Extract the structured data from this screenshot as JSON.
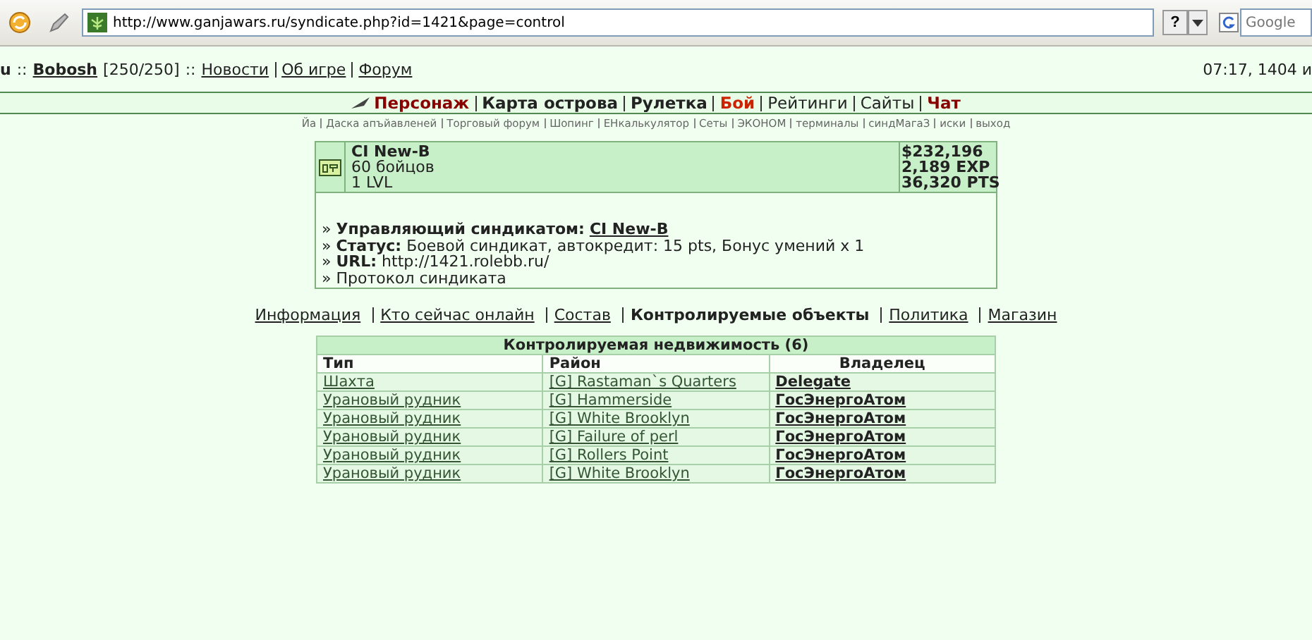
{
  "browser": {
    "url": "http://www.ganjawars.ru/syndicate.php?id=1421&page=control",
    "help": "?",
    "search": {
      "placeholder": "Google"
    }
  },
  "topbar": {
    "lead": "u",
    "sep": "::",
    "user": "Bobosh",
    "hp": "[250/250]",
    "sep2": "::",
    "links": [
      "Новости",
      "Об игре",
      "Форум"
    ],
    "clock": "07:17, 1404 и"
  },
  "nav": [
    {
      "label": "Персонаж",
      "kind": "accent"
    },
    {
      "label": "Карта острова",
      "kind": "bold"
    },
    {
      "label": "Рулетка",
      "kind": "bold"
    },
    {
      "label": "Бой",
      "kind": "alert"
    },
    {
      "label": "Рейтинги",
      "kind": "plain"
    },
    {
      "label": "Сайты",
      "kind": "plain"
    },
    {
      "label": "Чат",
      "kind": "accent"
    }
  ],
  "subnav": [
    "Йа",
    "Даска апъйавленей",
    "Торговый форум",
    "Шопинг",
    "ЕНкалькулятор",
    "Сеты",
    "ЭКОНОМ",
    "терминалы",
    "синдМагаЗ",
    "иски",
    "выход"
  ],
  "syndicate": {
    "name": "CI New-B",
    "fighters": "60 бойцов",
    "level": "1 LVL",
    "money": "$232,196",
    "exp": "2,189 EXP",
    "pts": "36,320 PTS",
    "info": [
      {
        "kind": "link",
        "marker": "»",
        "label": "Управляющий синдикатом:",
        "value": "CI New-B"
      },
      {
        "kind": "text",
        "marker": "»",
        "label": "Статус:",
        "value": "Боевой синдикат, автокредит: 15 pts, Бонус умений x 1"
      },
      {
        "kind": "text",
        "marker": "»",
        "label": "URL:",
        "value": "http://1421.rolebb.ru/"
      },
      {
        "kind": "plain",
        "marker": "»",
        "value": "Протокол синдиката"
      }
    ]
  },
  "tabs": [
    {
      "label": "Информация",
      "selected": false
    },
    {
      "label": "Кто сейчас онлайн",
      "selected": false
    },
    {
      "label": "Состав",
      "selected": false
    },
    {
      "label": "Контролируемые объекты",
      "selected": true
    },
    {
      "label": "Политика",
      "selected": false
    },
    {
      "label": "Магазин",
      "selected": false
    }
  ],
  "table": {
    "title": "Контролируемая недвижимость (6)",
    "columns": [
      "Тип",
      "Район",
      "Владелец"
    ],
    "rows": [
      [
        "Шахта",
        "[G] Rastaman`s Quarters",
        "Delegate"
      ],
      [
        "Урановый рудник",
        "[G] Hammerside",
        "ГосЭнергоАтом"
      ],
      [
        "Урановый рудник",
        "[G] White Brooklyn",
        "ГосЭнергоАтом"
      ],
      [
        "Урановый рудник",
        "[G] Failure of perl",
        "ГосЭнергоАтом"
      ],
      [
        "Урановый рудник",
        "[G] Rollers Point",
        "ГосЭнергоАтом"
      ],
      [
        "Урановый рудник",
        "[G] White Brooklyn",
        "ГосЭнергоАтом"
      ]
    ]
  }
}
